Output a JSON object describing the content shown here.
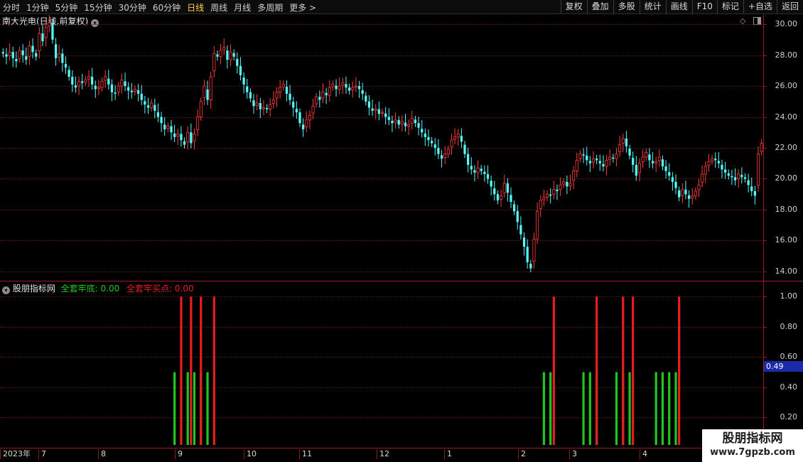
{
  "toolbar": {
    "periods": [
      "分时",
      "1分钟",
      "5分钟",
      "15分钟",
      "30分钟",
      "60分钟",
      "日线",
      "周线",
      "月线",
      "多周期",
      "更多 >"
    ],
    "active_period": "日线",
    "actions": [
      "复权",
      "叠加",
      "多股",
      "统计",
      "画线",
      "F10",
      "标记",
      "+自选",
      "返回"
    ]
  },
  "main_pane": {
    "title": "南大光电(日线,前复权)",
    "icons": [
      "diamond-icon",
      "window-toggle-icon"
    ]
  },
  "indicator_pane": {
    "name": "股朋指标网",
    "line1_label": "全套牢底: 0.00",
    "line2_label": "全套牢买点: 0.00",
    "current_value": "0.49"
  },
  "date_axis": [
    "2023年",
    "7",
    "8",
    "9",
    "10",
    "11",
    "12",
    "1",
    "2",
    "3",
    "4"
  ],
  "watermark": {
    "title": "股朋指标网",
    "url": "www.7gpzb.com"
  },
  "colors": {
    "up": "#ff3c3c",
    "down": "#54fcfc",
    "signal_red": "#e61e1e",
    "signal_green": "#1ec81e",
    "grid": "#5a1616",
    "active": "#ffd24a"
  },
  "chart_data": [
    {
      "type": "candlestick",
      "title": "南大光电(日线,前复权)",
      "y_ticks": [
        "30.00",
        "28.00",
        "26.00",
        "24.00",
        "22.00",
        "20.00",
        "18.00",
        "16.00",
        "14.00"
      ],
      "ylim": [
        13.4,
        30.6
      ],
      "x_ticks": [
        "2023年",
        "7",
        "8",
        "9",
        "10",
        "11",
        "12",
        "1",
        "2",
        "3",
        "4"
      ],
      "close_series": [
        28.1,
        27.9,
        28.2,
        27.8,
        27.6,
        28.3,
        28.0,
        27.7,
        28.6,
        28.2,
        27.9,
        29.4,
        28.9,
        29.8,
        30.1,
        29.0,
        27.8,
        28.1,
        27.5,
        27.2,
        26.6,
        26.1,
        25.9,
        26.3,
        26.2,
        26.4,
        26.6,
        26.1,
        25.8,
        25.9,
        26.3,
        26.6,
        26.1,
        25.6,
        25.5,
        26.0,
        26.4,
        26.0,
        25.7,
        25.6,
        25.8,
        25.5,
        25.1,
        24.8,
        24.6,
        24.9,
        24.4,
        24.0,
        23.6,
        23.2,
        23.4,
        23.0,
        22.7,
        22.9,
        22.5,
        22.2,
        23.0,
        22.3,
        22.9,
        24.0,
        25.0,
        26.0,
        25.1,
        26.6,
        28.1,
        27.9,
        28.3,
        28.5,
        27.7,
        28.2,
        27.9,
        27.3,
        26.7,
        26.1,
        25.6,
        25.2,
        24.7,
        24.9,
        24.5,
        24.6,
        24.5,
        24.8,
        25.1,
        25.6,
        25.9,
        26.1,
        25.5,
        25.1,
        24.6,
        24.3,
        23.6,
        23.2,
        23.8,
        24.1,
        24.7,
        25.3,
        25.1,
        25.6,
        25.4,
        25.9,
        26.1,
        25.8,
        26.0,
        26.2,
        25.9,
        25.7,
        25.9,
        26.0,
        25.8,
        25.5,
        25.0,
        24.6,
        24.4,
        24.5,
        24.2,
        24.3,
        24.0,
        23.8,
        23.6,
        23.8,
        23.5,
        23.7,
        23.4,
        23.5,
        23.9,
        23.6,
        23.3,
        23.0,
        22.7,
        22.5,
        22.3,
        22.0,
        21.6,
        21.3,
        21.6,
        21.9,
        22.5,
        22.7,
        22.9,
        22.4,
        21.6,
        20.9,
        20.6,
        20.4,
        20.7,
        20.5,
        20.3,
        20.0,
        19.5,
        19.0,
        18.6,
        18.9,
        19.7,
        19.1,
        18.5,
        17.9,
        17.2,
        16.4,
        15.6,
        14.6,
        14.2,
        16.1,
        17.9,
        18.6,
        18.8,
        19.0,
        18.9,
        19.3,
        19.2,
        19.6,
        19.8,
        19.5,
        19.7,
        20.5,
        21.2,
        21.6,
        21.5,
        21.2,
        21.0,
        21.3,
        21.2,
        21.0,
        20.8,
        21.2,
        21.4,
        21.3,
        21.6,
        22.2,
        22.6,
        22.1,
        21.5,
        20.9,
        20.2,
        21.0,
        21.4,
        21.7,
        21.2,
        21.0,
        21.1,
        21.4,
        20.8,
        20.5,
        20.2,
        19.8,
        19.4,
        18.8,
        19.3,
        19.0,
        18.7,
        18.9,
        19.2,
        19.6,
        20.3,
        20.8,
        21.1,
        21.3,
        21.2,
        21.0,
        20.6,
        20.4,
        20.2,
        20.1,
        19.9,
        20.3,
        20.1,
        20.0,
        19.6,
        19.2,
        18.9,
        21.6,
        22.3
      ]
    },
    {
      "type": "bar",
      "title": "股朋指标网",
      "y_ticks": [
        "1.00",
        "0.80",
        "0.60",
        "0.40",
        "0.20"
      ],
      "ylim": [
        0.0,
        1.1
      ],
      "series": [
        {
          "name": "全套牢底",
          "value": 0.5,
          "x_index": [
            52,
            56,
            58,
            60,
            62,
            164,
            166,
            176,
            178,
            180,
            186,
            188,
            190,
            198,
            200,
            202,
            204
          ]
        },
        {
          "name": "全套牢买点",
          "value": 1.0,
          "x_index": [
            54,
            57,
            60,
            64,
            167,
            180,
            188,
            191,
            205
          ]
        }
      ]
    }
  ]
}
